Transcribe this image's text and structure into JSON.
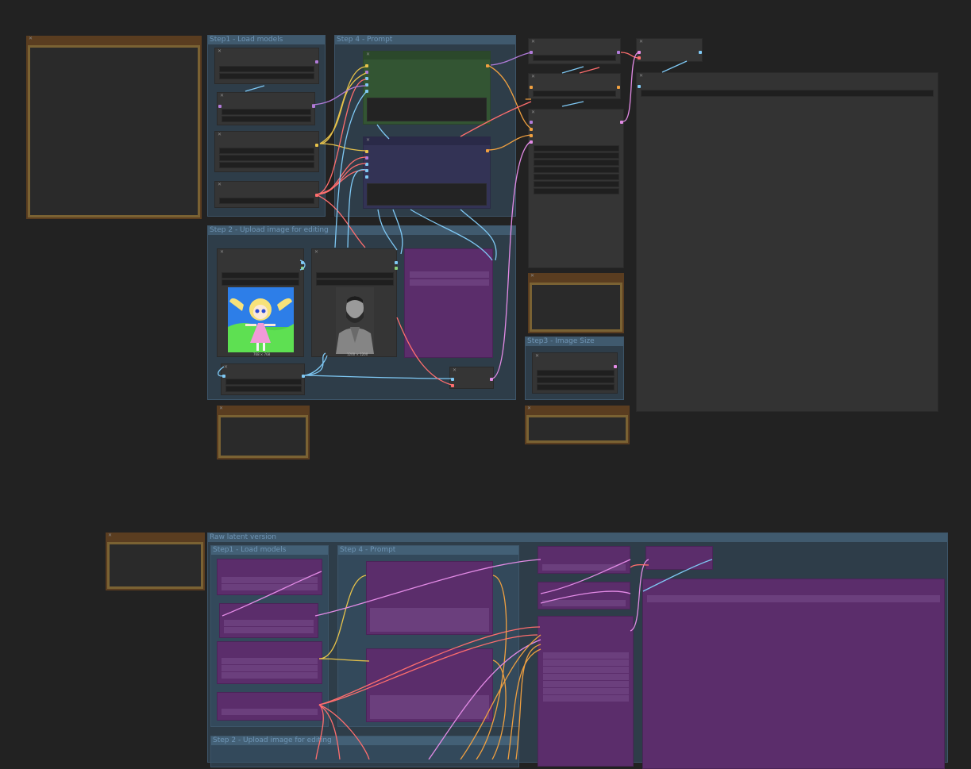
{
  "groups": {
    "step1_load_models": "Step1 - Load models",
    "step4_prompt": "Step 4 - Prompt",
    "step2_upload": "Step 2 - Upload image for editing",
    "step3_image_size": "Step3 - Image Size",
    "raw_latent_version": "Raw latent version",
    "raw_step1": "Step1 - Load models",
    "raw_step4": "Step 4 - Prompt",
    "raw_step2": "Step 2 - Upload image for editing"
  },
  "images": {
    "cartoon_caption": "768 × 768",
    "man_caption": "1200 × 1200"
  },
  "colors": {
    "canvas": "#222222",
    "group": "#38546a",
    "note": "#5a3d20",
    "purple_node": "#5b2d6b",
    "positive_prompt": "#335533",
    "negative_prompt": "#333355",
    "wire_yellow": "#e8c34a",
    "wire_red": "#ff6e6e",
    "wire_blue": "#7fc9f5",
    "wire_pink": "#e38be6",
    "wire_orange": "#f0a040"
  }
}
